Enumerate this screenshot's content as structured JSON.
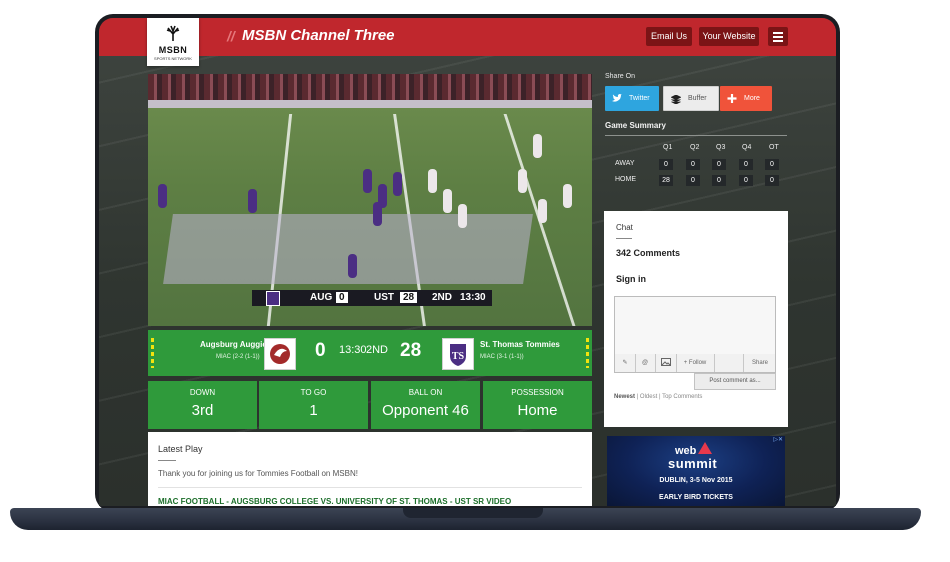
{
  "header": {
    "logo_text": "MSBN",
    "logo_subtext": "SPORTS NETWORK",
    "divider": "//",
    "channel_title": "MSBN Channel Three",
    "email_button": "Email Us",
    "website_button": "Your Website",
    "menu_icon": "hamburger-icon",
    "brand_color": "#c0272d"
  },
  "video": {
    "scorebug": {
      "away_abbr": "AUG",
      "away_score": "0",
      "home_abbr": "UST",
      "home_score": "28",
      "quarter": "2ND",
      "clock": "13:30"
    }
  },
  "scoreboard": {
    "away_name": "Augsburg Auggies",
    "away_record": "MIAC (2-2 (1-1))",
    "away_score": "0",
    "clock": "13:30",
    "quarter": "2ND",
    "home_score": "28",
    "home_name": "St. Thomas Tommies",
    "home_record": "MIAC (3-1 (1-1))",
    "color": "#2f9a3b"
  },
  "stats": [
    {
      "label": "DOWN",
      "value": "3rd"
    },
    {
      "label": "TO GO",
      "value": "1"
    },
    {
      "label": "BALL ON",
      "value": "Opponent 46"
    },
    {
      "label": "POSSESSION",
      "value": "Home"
    }
  ],
  "latest_play": {
    "title": "Latest Play",
    "message": "Thank you for joining us for Tommies Football on MSBN!",
    "headline": "MIAC FOOTBALL - AUGSBURG COLLEGE VS. UNIVERSITY OF ST. THOMAS - UST SR VIDEO"
  },
  "share": {
    "label": "Share On",
    "twitter": "Twitter",
    "buffer": "Buffer",
    "more": "More",
    "twitter_color": "#2ea5df",
    "more_color": "#f0533a"
  },
  "game_summary": {
    "title": "Game Summary",
    "columns": [
      "Q1",
      "Q2",
      "Q3",
      "Q4",
      "OT"
    ],
    "rows": [
      {
        "team": "AWAY",
        "values": [
          "0",
          "0",
          "0",
          "0",
          "0"
        ]
      },
      {
        "team": "HOME",
        "values": [
          "28",
          "0",
          "0",
          "0",
          "0"
        ]
      }
    ]
  },
  "chat": {
    "title": "Chat",
    "comments_count": "342 Comments",
    "sign_in": "Sign in",
    "follow": "+ Follow",
    "share": "Share",
    "post_button": "Post comment as...",
    "sort_newest": "Newest",
    "sort_oldest": "Oldest",
    "sort_top": "Top Comments",
    "sep": "|"
  },
  "ad": {
    "line1": "web",
    "line2": "summit",
    "line3": "DUBLIN, 3-5 Nov 2015",
    "line4": "EARLY BIRD TICKETS",
    "corner": "▷✕"
  }
}
